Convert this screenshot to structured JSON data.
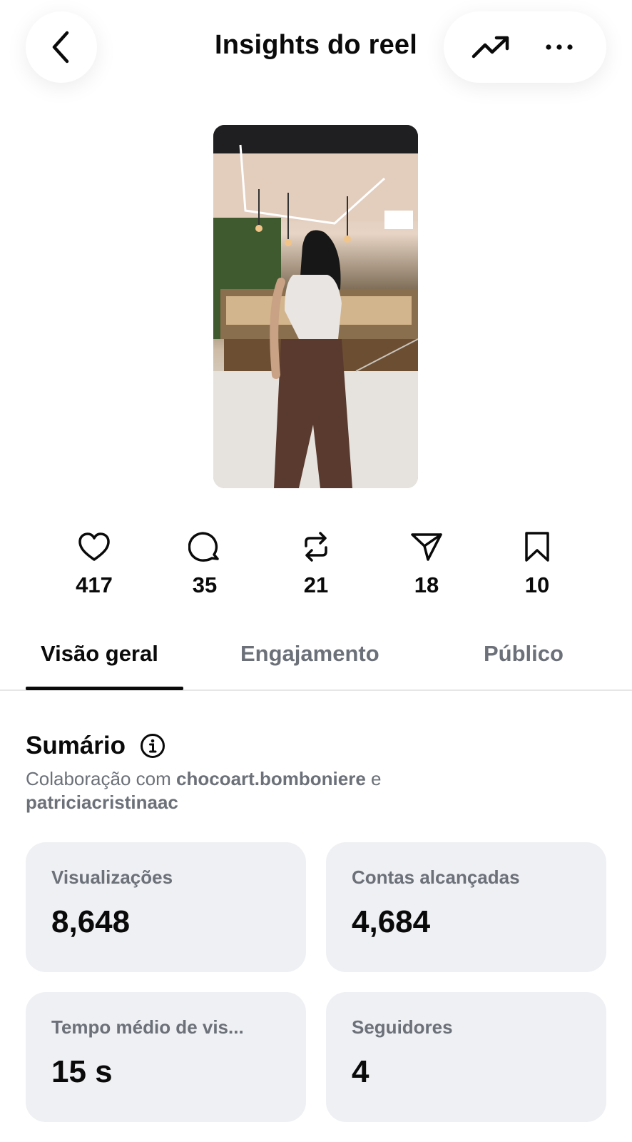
{
  "header": {
    "title": "Insights do reel",
    "back_icon": "chevron-left-icon",
    "trend_icon": "trending-up-icon",
    "more_icon": "more-horizontal-icon"
  },
  "thumbnail": {
    "alt_kind": "reel-video-thumbnail"
  },
  "engagement": [
    {
      "icon": "heart-icon",
      "count": "417"
    },
    {
      "icon": "comment-icon",
      "count": "35"
    },
    {
      "icon": "repost-icon",
      "count": "21"
    },
    {
      "icon": "share-icon",
      "count": "18"
    },
    {
      "icon": "bookmark-icon",
      "count": "10"
    }
  ],
  "tabs": [
    {
      "label": "Visão geral",
      "active": true
    },
    {
      "label": "Engajamento",
      "active": false
    },
    {
      "label": "Público",
      "active": false
    }
  ],
  "summary": {
    "title": "Sumário",
    "collab_prefix": "Colaboração com ",
    "collab_account_1": "chocoart.bomboniere",
    "collab_joiner": " e",
    "collab_account_2": "patriciacristinaac"
  },
  "cards": [
    {
      "label": "Visualizações",
      "value": "8,648"
    },
    {
      "label": "Contas alcançadas",
      "value": "4,684"
    },
    {
      "label": "Tempo médio de vis...",
      "value": "15 s"
    },
    {
      "label": "Seguidores",
      "value": "4"
    }
  ],
  "colors": {
    "card_bg": "#eff0f3",
    "muted_text": "#6b7079",
    "text": "#0a0a0a"
  }
}
